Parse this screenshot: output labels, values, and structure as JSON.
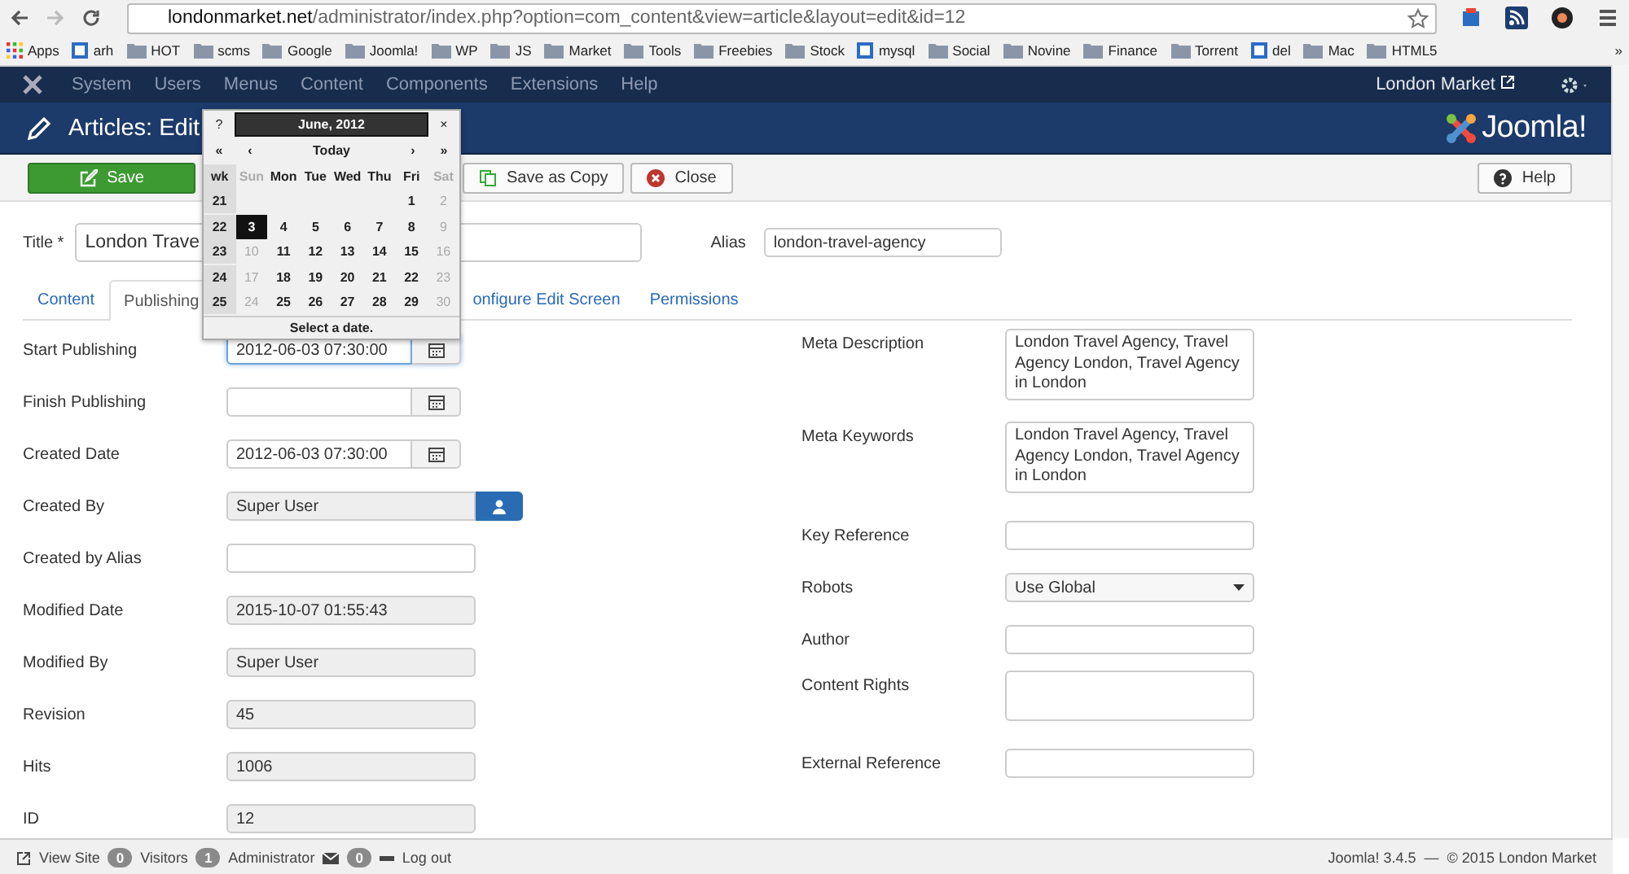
{
  "browser": {
    "url_host": "londonmarket.net",
    "url_path": "/administrator/index.php?option=com_content&view=article&layout=edit&id=12",
    "bookmarks": [
      {
        "kind": "apps",
        "label": "Apps"
      },
      {
        "kind": "site",
        "label": "arh"
      },
      {
        "kind": "folder",
        "label": "HOT"
      },
      {
        "kind": "folder",
        "label": "scms"
      },
      {
        "kind": "folder",
        "label": "Google"
      },
      {
        "kind": "folder",
        "label": "Joomla!"
      },
      {
        "kind": "folder",
        "label": "WP"
      },
      {
        "kind": "folder",
        "label": "JS"
      },
      {
        "kind": "folder",
        "label": "Market"
      },
      {
        "kind": "folder",
        "label": "Tools"
      },
      {
        "kind": "folder",
        "label": "Freebies"
      },
      {
        "kind": "folder",
        "label": "Stock"
      },
      {
        "kind": "site",
        "label": "mysql"
      },
      {
        "kind": "folder",
        "label": "Social"
      },
      {
        "kind": "folder",
        "label": "Novine"
      },
      {
        "kind": "folder",
        "label": "Finance"
      },
      {
        "kind": "folder",
        "label": "Torrent"
      },
      {
        "kind": "site",
        "label": "del"
      },
      {
        "kind": "folder",
        "label": "Mac"
      },
      {
        "kind": "folder",
        "label": "HTML5"
      }
    ],
    "more": "»"
  },
  "navbar": {
    "menu": [
      "System",
      "Users",
      "Menus",
      "Content",
      "Components",
      "Extensions",
      "Help"
    ],
    "site_link": "London Market"
  },
  "header": {
    "title": "Articles: Edit",
    "logo": "Joomla!"
  },
  "toolbar": [
    {
      "kind": "save",
      "label": "Save"
    },
    {
      "kind": "copy",
      "label": "Save as Copy"
    },
    {
      "kind": "close",
      "label": "Close"
    }
  ],
  "help": "Help",
  "title_field": {
    "label": "Title *",
    "value": "London Trave"
  },
  "alias_field": {
    "label": "Alias",
    "value": "london-travel-agency"
  },
  "tabs": [
    {
      "label": "Content",
      "selected": false
    },
    {
      "label": "Publishing",
      "selected": true
    },
    {
      "label": "onfigure Edit Screen",
      "selected": false
    },
    {
      "label": "Permissions",
      "selected": false
    }
  ],
  "left_fields": [
    {
      "kind": "date",
      "label": "Start Publishing",
      "value": "2012-06-03 07:30:00",
      "focused": true
    },
    {
      "kind": "date",
      "label": "Finish Publishing",
      "focused": false
    },
    {
      "kind": "date",
      "label": "Created Date",
      "value": "2012-06-03 07:30:00",
      "focused": false
    },
    {
      "kind": "user",
      "label": "Created By",
      "value": "Super User",
      "focused": false
    },
    {
      "kind": "input",
      "label": "Created by Alias",
      "focused": false
    },
    {
      "kind": "readonly",
      "label": "Modified Date",
      "value": "2015-10-07 01:55:43",
      "focused": false
    },
    {
      "kind": "readonly",
      "label": "Modified By",
      "value": "Super User",
      "focused": false
    },
    {
      "kind": "readonly",
      "label": "Revision",
      "value": "45",
      "focused": false
    },
    {
      "kind": "readonly",
      "label": "Hits",
      "value": "1006",
      "focused": false
    },
    {
      "kind": "readonly",
      "label": "ID",
      "value": "12",
      "focused": false
    }
  ],
  "right_fields": [
    {
      "kind": "textarea",
      "label": "Meta Description",
      "value": "London Travel Agency, Travel Agency London, Travel Agency in London"
    },
    {
      "kind": "textarea",
      "label": "Meta Keywords",
      "value": "London Travel Agency, Travel Agency London, Travel Agency in London"
    },
    {
      "kind": "input",
      "label": "Key Reference"
    },
    {
      "kind": "select",
      "label": "Robots",
      "value": "Use Global"
    },
    {
      "kind": "input",
      "label": "Author"
    },
    {
      "kind": "textarea",
      "label": "Content Rights"
    },
    {
      "kind": "input",
      "label": "External Reference"
    }
  ],
  "calendar": {
    "help": "?",
    "title": "June, 2012",
    "close": "×",
    "nav": [
      "«",
      "‹",
      "Today",
      "›",
      "»"
    ],
    "weekdays": [
      {
        "label": "wk",
        "muted": false
      },
      {
        "label": "Sun",
        "muted": true
      },
      {
        "label": "Mon",
        "muted": false
      },
      {
        "label": "Tue",
        "muted": false
      },
      {
        "label": "Wed",
        "muted": false
      },
      {
        "label": "Thu",
        "muted": false
      },
      {
        "label": "Fri",
        "muted": false
      },
      {
        "label": "Sat",
        "muted": true
      }
    ],
    "weeks": [
      {
        "wk": "21",
        "days": [
          {
            "text": "1",
            "muted": false,
            "selected": false
          },
          {
            "text": "2",
            "muted": true,
            "selected": false
          }
        ]
      },
      {
        "wk": "22",
        "days": [
          {
            "text": "3",
            "muted": false,
            "selected": true
          },
          {
            "text": "4",
            "muted": false,
            "selected": false
          },
          {
            "text": "5",
            "muted": false,
            "selected": false
          },
          {
            "text": "6",
            "muted": false,
            "selected": false
          },
          {
            "text": "7",
            "muted": false,
            "selected": false
          },
          {
            "text": "8",
            "muted": false,
            "selected": false
          },
          {
            "text": "9",
            "muted": true,
            "selected": false
          }
        ]
      },
      {
        "wk": "23",
        "days": [
          {
            "text": "10",
            "muted": true,
            "selected": false
          },
          {
            "text": "11",
            "muted": false,
            "selected": false
          },
          {
            "text": "12",
            "muted": false,
            "selected": false
          },
          {
            "text": "13",
            "muted": false,
            "selected": false
          },
          {
            "text": "14",
            "muted": false,
            "selected": false
          },
          {
            "text": "15",
            "muted": false,
            "selected": false
          },
          {
            "text": "16",
            "muted": true,
            "selected": false
          }
        ]
      },
      {
        "wk": "24",
        "days": [
          {
            "text": "17",
            "muted": true,
            "selected": false
          },
          {
            "text": "18",
            "muted": false,
            "selected": false
          },
          {
            "text": "19",
            "muted": false,
            "selected": false
          },
          {
            "text": "20",
            "muted": false,
            "selected": false
          },
          {
            "text": "21",
            "muted": false,
            "selected": false
          },
          {
            "text": "22",
            "muted": false,
            "selected": false
          },
          {
            "text": "23",
            "muted": true,
            "selected": false
          }
        ]
      },
      {
        "wk": "25",
        "days": [
          {
            "text": "24",
            "muted": true,
            "selected": false
          },
          {
            "text": "25",
            "muted": false,
            "selected": false
          },
          {
            "text": "26",
            "muted": false,
            "selected": false
          },
          {
            "text": "27",
            "muted": false,
            "selected": false
          },
          {
            "text": "28",
            "muted": false,
            "selected": false
          },
          {
            "text": "29",
            "muted": false,
            "selected": false
          },
          {
            "text": "30",
            "muted": true,
            "selected": false
          }
        ]
      }
    ],
    "status": "Select a date."
  },
  "footer": {
    "view_site": "View Site",
    "visitors_count": "0",
    "visitors": "Visitors",
    "admin_count": "1",
    "admin": "Administrator",
    "messages_count": "0",
    "logout": "Log out",
    "version": "Joomla! 3.4.5",
    "separator": "—",
    "copyright": "© 2015 London Market"
  }
}
